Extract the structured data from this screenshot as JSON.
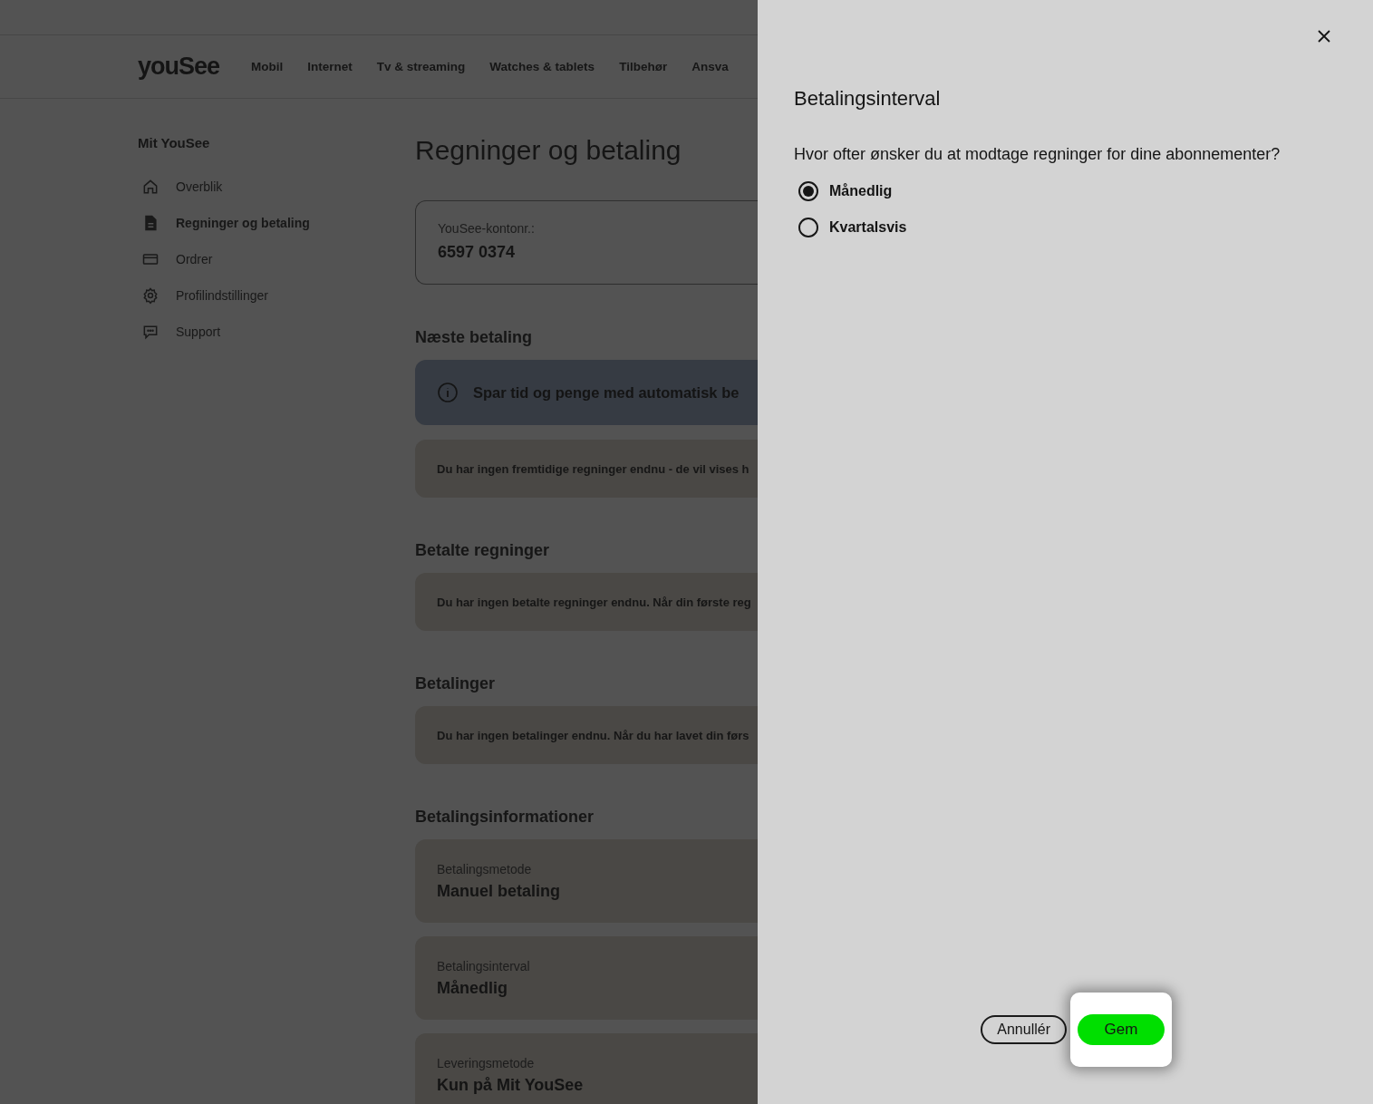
{
  "header": {
    "logo": "youSee",
    "nav": [
      "Mobil",
      "Internet",
      "Tv & streaming",
      "Watches & tablets",
      "Tilbehør",
      "Ansva"
    ]
  },
  "sidebar": {
    "title": "Mit YouSee",
    "items": [
      {
        "label": "Overblik",
        "selected": false
      },
      {
        "label": "Regninger og betaling",
        "selected": true
      },
      {
        "label": "Ordrer",
        "selected": false
      },
      {
        "label": "Profilindstillinger",
        "selected": false
      },
      {
        "label": "Support",
        "selected": false
      }
    ]
  },
  "main": {
    "title": "Regninger og betaling",
    "account": {
      "label": "YouSee-kontonr.:",
      "value": "6597 0374"
    },
    "sections": [
      {
        "heading": "Næste betaling",
        "info": "Spar tid og penge med automatisk be",
        "note": "Du har ingen fremtidige regninger endnu - de vil vises h"
      },
      {
        "heading": "Betalte regninger",
        "note": "Du har ingen betalte regninger endnu. Når din første reg"
      },
      {
        "heading": "Betalinger",
        "note": "Du har ingen betalinger endnu. Når du har lavet din førs"
      }
    ],
    "info_heading": "Betalingsinformationer",
    "info_cards": [
      {
        "label": "Betalingsmetode",
        "value": "Manuel betaling"
      },
      {
        "label": "Betalingsinterval",
        "value": "Månedlig"
      },
      {
        "label": "Leveringsmetode",
        "value": "Kun på Mit YouSee"
      }
    ]
  },
  "drawer": {
    "title": "Betalingsinterval",
    "question": "Hvor ofter ønsker du at modtage regninger for dine abonnementer?",
    "options": [
      {
        "label": "Månedlig",
        "selected": true
      },
      {
        "label": "Kvartalsvis",
        "selected": false
      }
    ],
    "cancel": "Annullér",
    "save": "Gem",
    "save_highlighted": true
  }
}
